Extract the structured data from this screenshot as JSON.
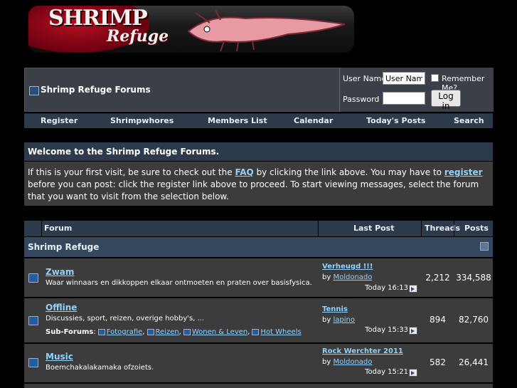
{
  "logo": {
    "line1": "SHRIMP",
    "line2": "Refuge"
  },
  "header": {
    "title": "Shrimp Refuge Forums"
  },
  "login": {
    "username_label": "User Name",
    "username_value": "User Name",
    "password_label": "Password",
    "remember_label": "Remember Me?",
    "login_button": "Log in"
  },
  "nav": [
    "Register",
    "Shrimpwhores",
    "Members List",
    "Calendar",
    "Today's Posts",
    "Search"
  ],
  "welcome": {
    "title": "Welcome to the Shrimp Refuge Forums.",
    "text1": "If this is your first visit, be sure to check out the ",
    "faq": "FAQ",
    "text2": " by clicking the link above. You may have to ",
    "register": "register",
    "text3": " before you can post: click the register link above to proceed. To start viewing messages, select the forum that you want to visit from the selection below."
  },
  "table": {
    "headers": {
      "forum": "Forum",
      "last_post": "Last Post",
      "threads": "Threads",
      "posts": "Posts"
    },
    "category": "Shrimp Refuge",
    "forums": [
      {
        "name": "Zwam",
        "desc": "Waar winnaars en dikkoppen elkaar ontmoeten en praten over basisfysica.",
        "last_title": "Verheugd !!!",
        "by_label": "by",
        "last_by": "Moldonado",
        "last_time": "Today 16:13",
        "threads": "2,212",
        "posts": "334,588"
      },
      {
        "name": "Offline",
        "desc": "Discussies, sport, reizen, overige hobby's, ...",
        "subforums_label": "Sub-Forums",
        "subforums": [
          "Fotografie",
          "Reizen",
          "Wonen & Leven",
          "Hot Wheels"
        ],
        "last_title": "Tennis",
        "by_label": "by",
        "last_by": "lapino",
        "last_time": "Today 15:33",
        "threads": "894",
        "posts": "82,760"
      },
      {
        "name": "Music",
        "desc": "Boemchakalakamaka ofzoiets.",
        "last_title": "Rock Werchter 2011",
        "by_label": "by",
        "last_by": "Moldonado",
        "last_time": "Today 15:21",
        "threads": "582",
        "posts": "26,441"
      }
    ]
  }
}
